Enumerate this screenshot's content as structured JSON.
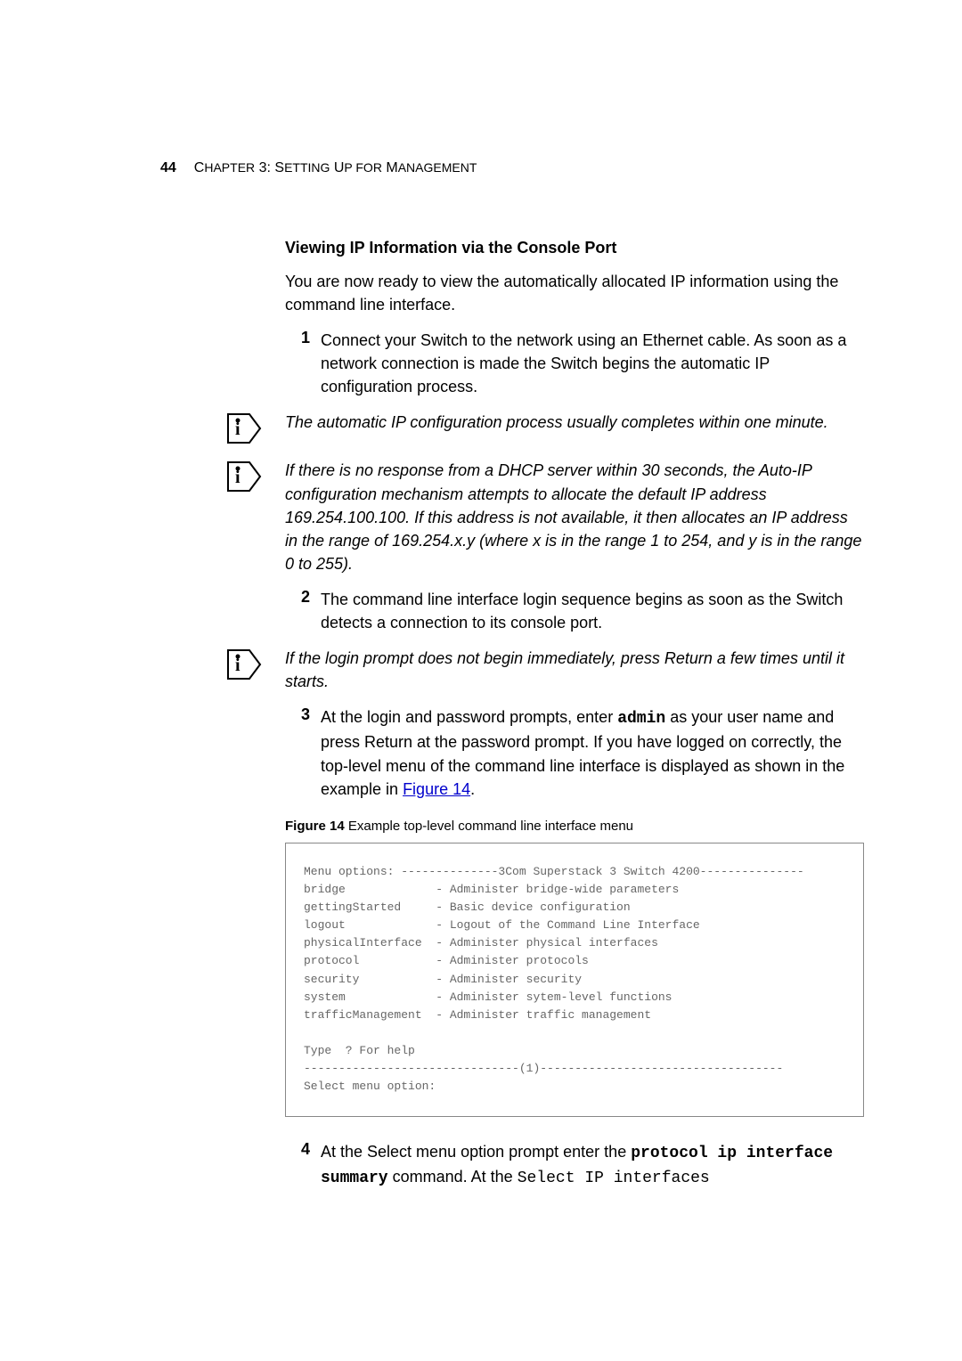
{
  "header": {
    "page_number": "44",
    "chapter_prefix": "C",
    "chapter_text_1": "HAPTER",
    "chapter_num": " 3: S",
    "chapter_text_2": "ETTING",
    "chapter_sp1": " U",
    "chapter_text_3": "P FOR",
    "chapter_sp2": " M",
    "chapter_text_4": "ANAGEMENT"
  },
  "section_title": "Viewing IP Information via the Console Port",
  "intro": "You are now ready to view the automatically allocated IP information using the command line interface.",
  "step1": {
    "num": "1",
    "text": "Connect your Switch to the network using an Ethernet cable. As soon as a network connection is made the Switch begins the automatic IP configuration process."
  },
  "note1": "The automatic IP configuration process usually completes within one minute.",
  "note2": "If there is no response from a DHCP server within 30 seconds, the Auto-IP configuration mechanism attempts to allocate the default IP address 169.254.100.100. If this address is not available, it then allocates an IP address in the range of 169.254.x.y (where x is in the range 1 to 254, and y is in the range 0 to 255).",
  "step2": {
    "num": "2",
    "text": "The command line interface login sequence begins as soon as the Switch detects a connection to its console port."
  },
  "note3": "If the login prompt does not begin immediately, press Return a few times until it starts.",
  "step3": {
    "num": "3",
    "pre": "At the login and password prompts, enter ",
    "cmd": "admin",
    "post1": " as your user name and press Return at the password prompt. If you have logged on correctly, the top-level menu of the command line interface is displayed as shown in the example in ",
    "figlink": "Figure 14",
    "post2": "."
  },
  "figure": {
    "label": "Figure 14",
    "caption": "   Example top-level command line interface menu"
  },
  "cli": "Menu options: --------------3Com Superstack 3 Switch 4200---------------\nbridge             - Administer bridge-wide parameters\ngettingStarted     - Basic device configuration\nlogout             - Logout of the Command Line Interface\nphysicalInterface  - Administer physical interfaces\nprotocol           - Administer protocols\nsecurity           - Administer security\nsystem             - Administer sytem-level functions\ntrafficManagement  - Administer traffic management\n\nType  ? For help\n-------------------------------(1)-----------------------------------\nSelect menu option:",
  "step4": {
    "num": "4",
    "pre": "At the Select menu option prompt enter the ",
    "cmd": "protocol ip interface summary",
    "post1": " command. At the ",
    "mono": "Select IP interfaces"
  }
}
